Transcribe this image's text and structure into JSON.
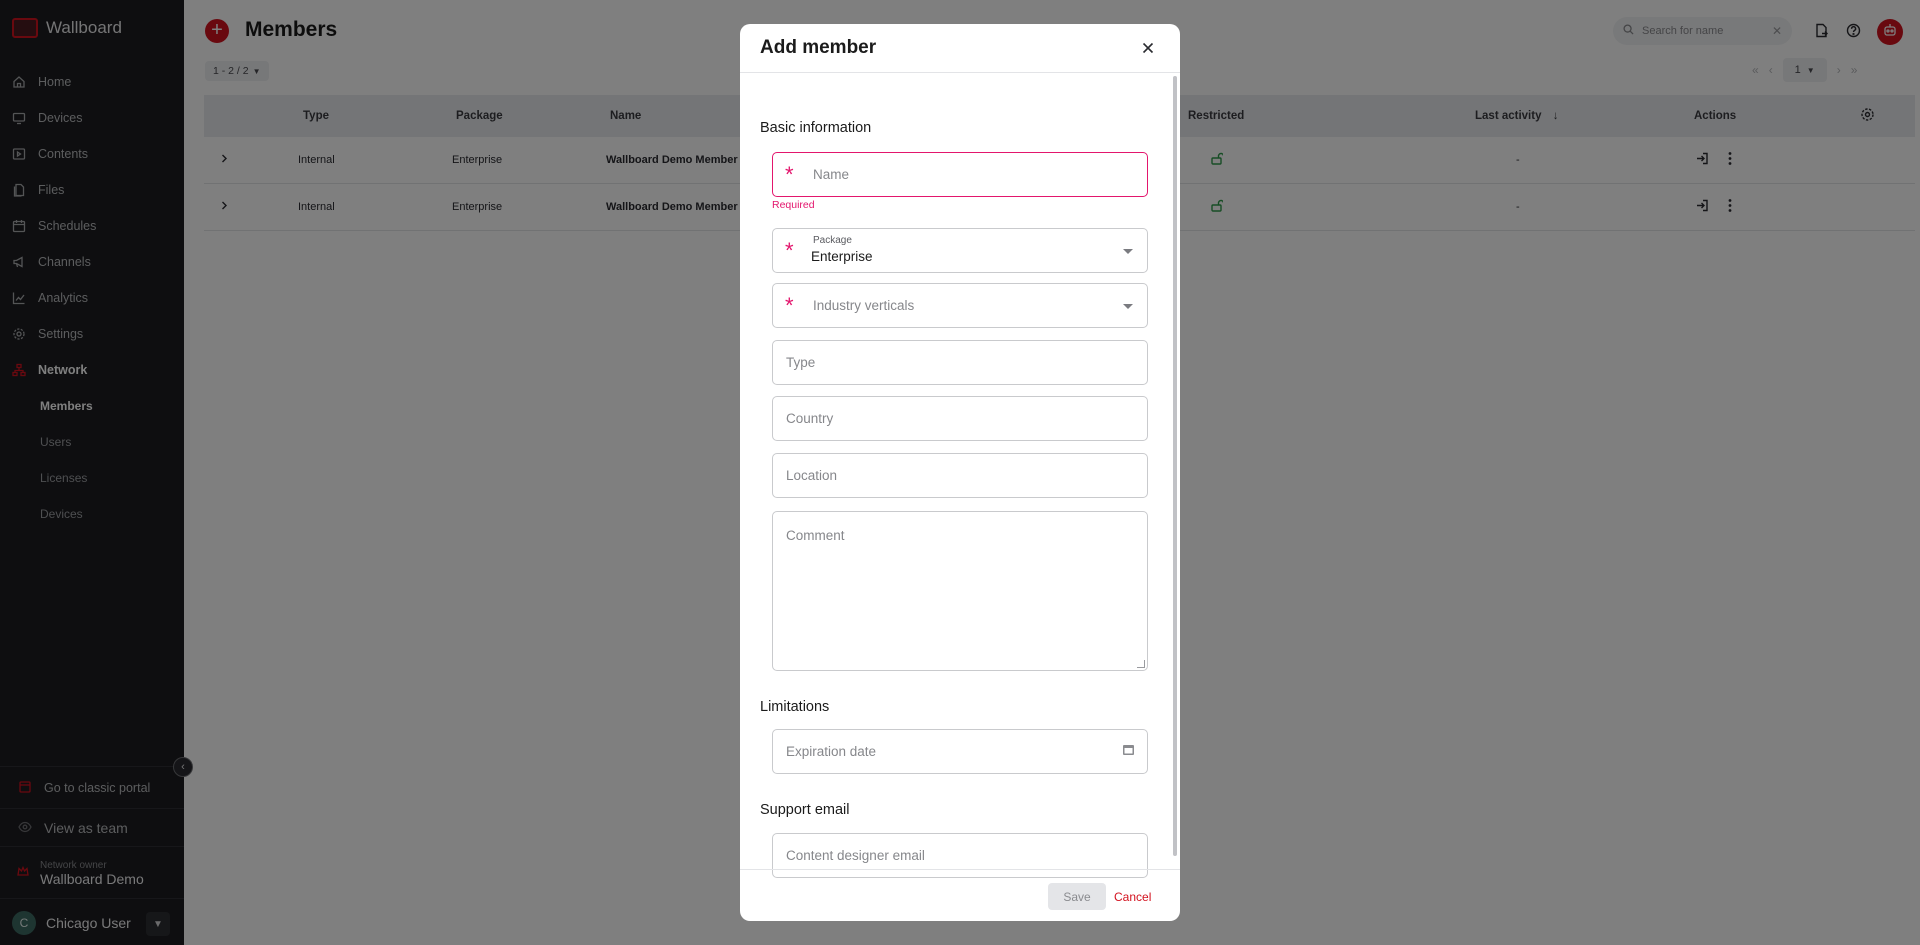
{
  "app": {
    "name": "Wallboard"
  },
  "sidebar": {
    "items": [
      {
        "label": "Home",
        "icon": "home-icon"
      },
      {
        "label": "Devices",
        "icon": "monitor-icon"
      },
      {
        "label": "Contents",
        "icon": "play-icon"
      },
      {
        "label": "Files",
        "icon": "files-icon"
      },
      {
        "label": "Schedules",
        "icon": "calendar-icon"
      },
      {
        "label": "Channels",
        "icon": "megaphone-icon"
      },
      {
        "label": "Analytics",
        "icon": "chart-icon"
      },
      {
        "label": "Settings",
        "icon": "gear-icon"
      },
      {
        "label": "Network",
        "icon": "network-icon"
      }
    ],
    "subitems": [
      {
        "label": "Members"
      },
      {
        "label": "Users"
      },
      {
        "label": "Licenses"
      },
      {
        "label": "Devices"
      }
    ],
    "classic_portal": "Go to classic portal",
    "view_as_team": "View as team",
    "owner_label": "Network owner",
    "owner_name": "Wallboard Demo",
    "user_initial": "C",
    "user_name": "Chicago User"
  },
  "header": {
    "title": "Members",
    "search_placeholder": "Search for name"
  },
  "pagination": {
    "range": "1 - 2 / 2",
    "page": "1"
  },
  "table": {
    "columns": {
      "type": "Type",
      "package": "Package",
      "name": "Name",
      "restricted": "Restricted",
      "last_activity": "Last activity",
      "actions": "Actions"
    },
    "rows": [
      {
        "type": "Internal",
        "package": "Enterprise",
        "name": "Wallboard Demo Member",
        "last_activity": "-"
      },
      {
        "type": "Internal",
        "package": "Enterprise",
        "name": "Wallboard Demo Member",
        "last_activity": "-"
      }
    ]
  },
  "modal": {
    "title": "Add member",
    "basic_section": "Basic information",
    "name_placeholder": "Name",
    "name_error": "Required",
    "package_label": "Package",
    "package_value": "Enterprise",
    "industry_placeholder": "Industry verticals",
    "type_placeholder": "Type",
    "country_placeholder": "Country",
    "location_placeholder": "Location",
    "comment_placeholder": "Comment",
    "limitations_section": "Limitations",
    "expiration_placeholder": "Expiration date",
    "support_section": "Support email",
    "support_placeholder": "Content designer email",
    "save_label": "Save",
    "cancel_label": "Cancel"
  },
  "colors": {
    "brand": "#d3121f",
    "error": "#e3166d",
    "sidebar_bg": "#1c1d21",
    "unlocked": "#2e9b4a"
  }
}
